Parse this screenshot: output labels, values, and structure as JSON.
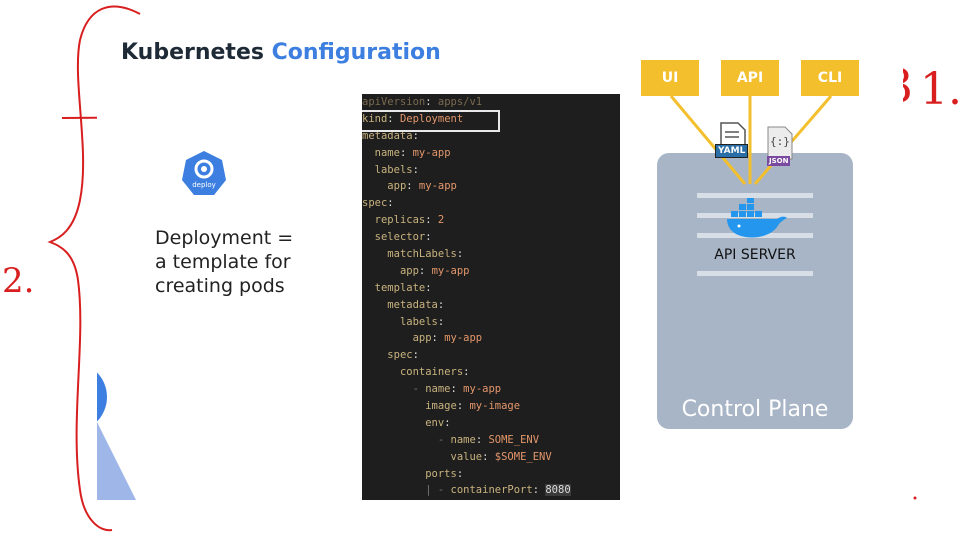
{
  "title": {
    "part1": "Kubernetes ",
    "part2": "Configuration"
  },
  "deployment": {
    "icon_label": "deploy",
    "text": "Deployment =\na template for\ncreating pods"
  },
  "code_lines": [
    {
      "indent": "",
      "key": "apiVersion",
      "value": "apps/v1",
      "faded": true
    },
    {
      "indent": "",
      "key": "kind",
      "value": "Deployment"
    },
    {
      "indent": "",
      "key": "metadata",
      "value": ""
    },
    {
      "indent": "  ",
      "key": "name",
      "value": "my-app"
    },
    {
      "indent": "  ",
      "key": "labels",
      "value": ""
    },
    {
      "indent": "    ",
      "key": "app",
      "value": "my-app"
    },
    {
      "indent": "",
      "key": "spec",
      "value": ""
    },
    {
      "indent": "  ",
      "key": "replicas",
      "value": "2"
    },
    {
      "indent": "  ",
      "key": "selector",
      "value": ""
    },
    {
      "indent": "    ",
      "key": "matchLabels",
      "value": ""
    },
    {
      "indent": "      ",
      "key": "app",
      "value": "my-app"
    },
    {
      "indent": "  ",
      "key": "template",
      "value": ""
    },
    {
      "indent": "    ",
      "key": "metadata",
      "value": ""
    },
    {
      "indent": "      ",
      "key": "labels",
      "value": ""
    },
    {
      "indent": "        ",
      "key": "app",
      "value": "my-app"
    },
    {
      "indent": "    ",
      "key": "spec",
      "value": ""
    },
    {
      "indent": "      ",
      "key": "containers",
      "value": ""
    },
    {
      "indent": "        - ",
      "key": "name",
      "value": "my-app"
    },
    {
      "indent": "          ",
      "key": "image",
      "value": "my-image"
    },
    {
      "indent": "          ",
      "key": "env",
      "value": ""
    },
    {
      "indent": "            - ",
      "key": "name",
      "value": "SOME_ENV"
    },
    {
      "indent": "              ",
      "key": "value",
      "value": "$SOME_ENV"
    },
    {
      "indent": "          ",
      "key": "ports",
      "value": ""
    },
    {
      "indent": "          | - ",
      "key": "containerPort",
      "value": "8080",
      "number": true
    }
  ],
  "sources": {
    "ui": "UI",
    "api": "API",
    "cli": "CLI"
  },
  "files": {
    "yaml": "YAML",
    "json_symbol": "{:}",
    "json": "JSON"
  },
  "control_plane": {
    "api_server": "API SERVER",
    "label": "Control Plane"
  },
  "annotations": {
    "one": "1.",
    "two": "2.",
    "three": "3"
  },
  "colors": {
    "accent": "#3d7fe0",
    "source_box": "#f3bf2c",
    "ink": "#d81e1e",
    "panel": "#a7b5c6"
  }
}
